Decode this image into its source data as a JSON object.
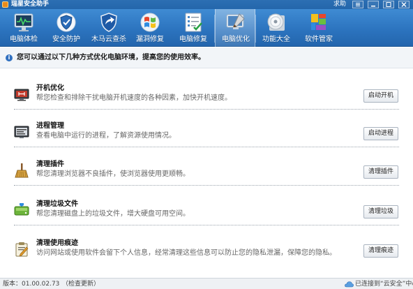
{
  "window": {
    "title": "瑞星安全助手",
    "help_label": "求助",
    "icons": [
      "app-logo",
      "menu-icon",
      "minimize-icon",
      "maximize-icon",
      "close-icon"
    ]
  },
  "toolbar": {
    "active_index": 5,
    "items": [
      {
        "label": "电脑体检",
        "icon": "monitor-checkup-icon"
      },
      {
        "label": "安全防护",
        "icon": "shield-protection-icon"
      },
      {
        "label": "木马云查杀",
        "icon": "shield-cloud-scan-icon"
      },
      {
        "label": "漏洞修复",
        "icon": "windows-patch-icon"
      },
      {
        "label": "电脑修复",
        "icon": "checklist-repair-icon"
      },
      {
        "label": "电脑优化",
        "icon": "brush-optimize-icon"
      },
      {
        "label": "功能大全",
        "icon": "cd-tools-icon"
      },
      {
        "label": "软件管家",
        "icon": "software-blocks-icon"
      }
    ]
  },
  "info": {
    "icon": "info-icon",
    "text": "您可以通过以下几种方式优化电脑环境，提高您的使用效率。"
  },
  "items": [
    {
      "title": "开机优化",
      "description": "帮您检查和排除干扰电脑开机速度的各种因素，加快开机速度。",
      "button": "启动开机",
      "icon": "startup-optimize-icon"
    },
    {
      "title": "进程管理",
      "description": "查看电脑中运行的进程，了解资源使用情况。",
      "button": "启动进程",
      "icon": "process-monitor-icon"
    },
    {
      "title": "清理插件",
      "description": "帮您清理浏览器不良插件，使浏览器使用更顺畅。",
      "button": "清理插件",
      "icon": "broom-icon"
    },
    {
      "title": "清理垃圾文件",
      "description": "帮您清理磁盘上的垃圾文件，增大硬盘可用空间。",
      "button": "清理垃圾",
      "icon": "disk-clean-icon"
    },
    {
      "title": "清理使用痕迹",
      "description": "访问网站或使用软件会留下个人信息，经常清理这些信息可以防止您的隐私泄漏，保障您的隐私。",
      "button": "清理痕迹",
      "icon": "clipboard-trace-icon"
    }
  ],
  "status": {
    "version": "版本：01.00.02.73",
    "update_link": "（检查更新）",
    "connection": "已连接到“云安全”中心",
    "icon": "cloud-icon"
  }
}
